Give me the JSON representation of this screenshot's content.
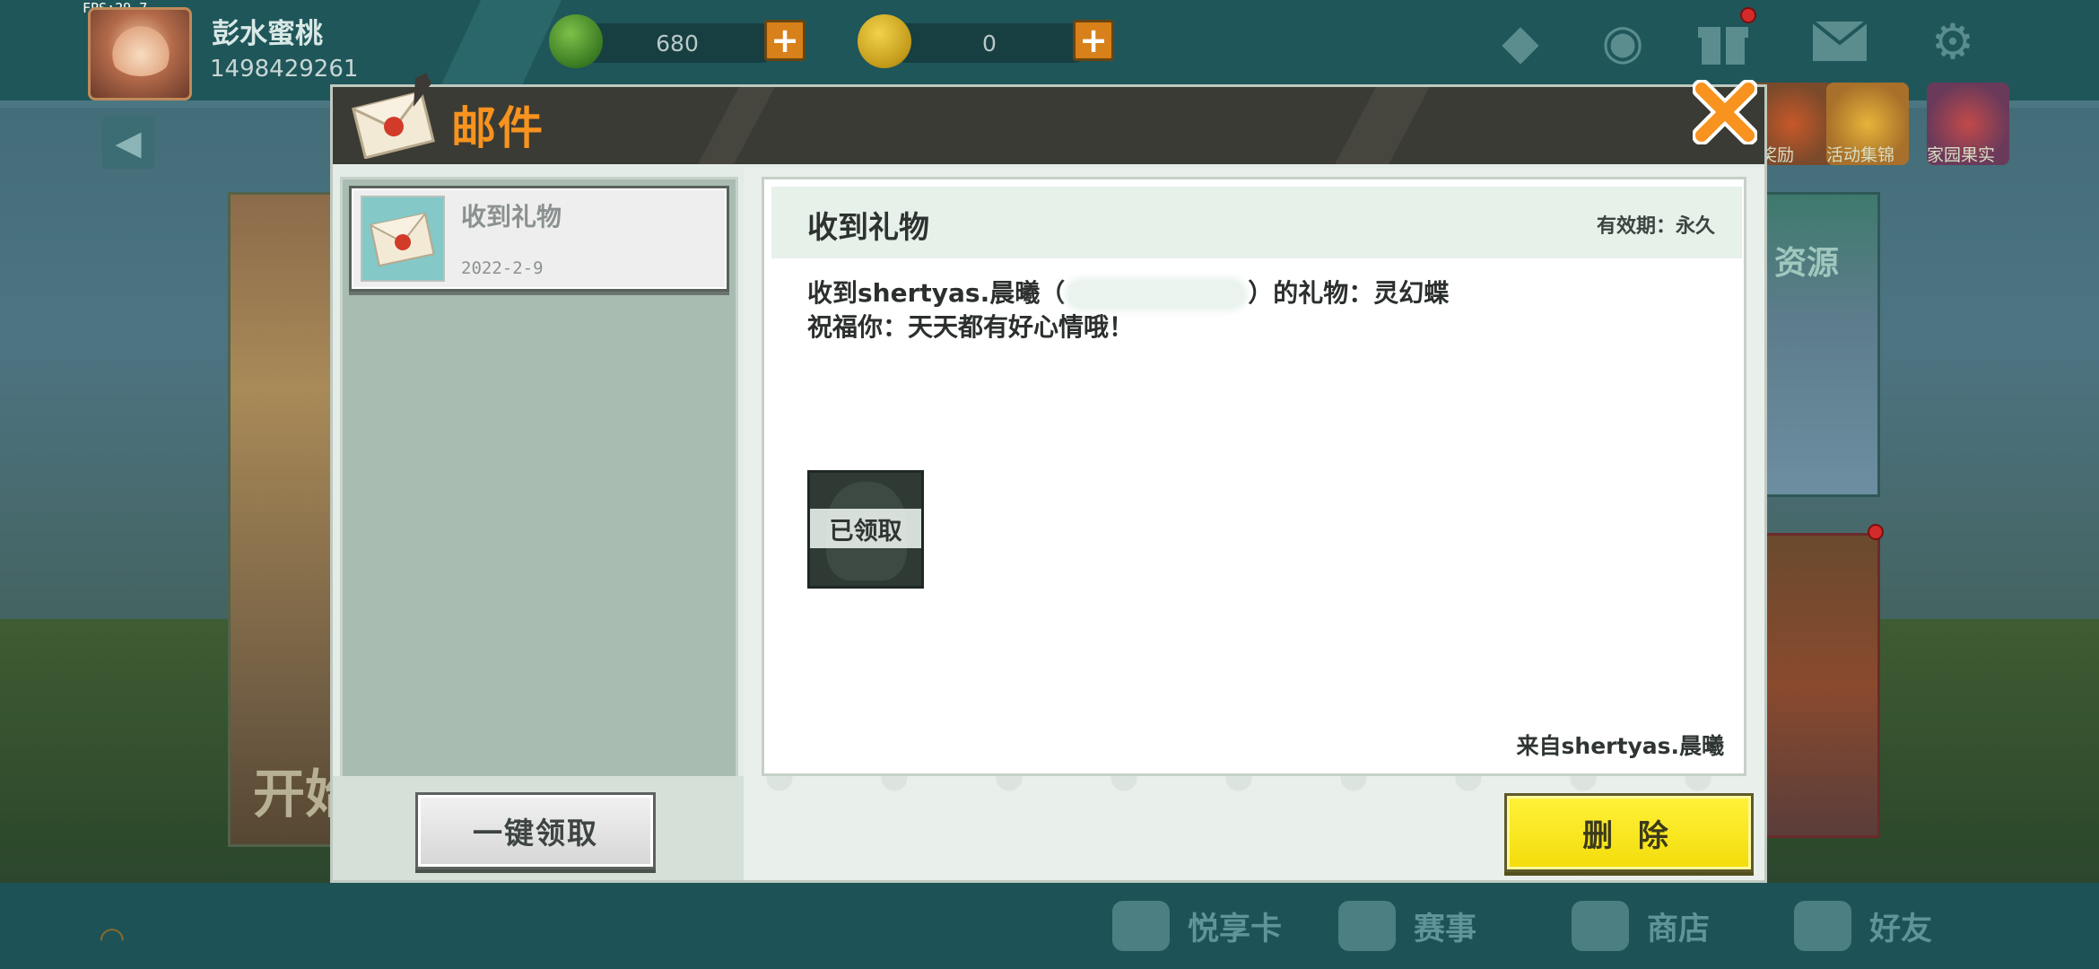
{
  "hud": {
    "fps": "FPS:29.7",
    "username": "彭水蜜桃",
    "user_id": "1498429261",
    "mini_beans": "680",
    "mini_coins": "0"
  },
  "right_shortcuts": [
    {
      "label": "奖励"
    },
    {
      "label": "活动集锦"
    },
    {
      "label": "家园果实"
    }
  ],
  "resource_card_label": "资源",
  "start_card_label": "开始",
  "bottom_nav": [
    {
      "label": "悦享卡"
    },
    {
      "label": "赛事"
    },
    {
      "label": "商店"
    },
    {
      "label": "好友"
    }
  ],
  "mail_dialog": {
    "title": "邮件",
    "mail_list": [
      {
        "title": "收到礼物",
        "date": "2022-2-9"
      }
    ],
    "claim_all_label": "一键领取",
    "detail": {
      "title": "收到礼物",
      "validity_label": "有效期：",
      "validity_value": "永久",
      "line1_prefix": "收到shertyas.晨曦（",
      "line1_suffix": "）的礼物：灵幻蝶",
      "line2": "祝福你：天天都有好心情哦！",
      "attachment_status": "已领取",
      "sender": "来自shertyas.晨曦"
    },
    "delete_label": "删 除"
  },
  "colors": {
    "title_orange": "#f7931e",
    "delete_yellow": "#f7e51c",
    "header_dark": "#3b3b35"
  }
}
